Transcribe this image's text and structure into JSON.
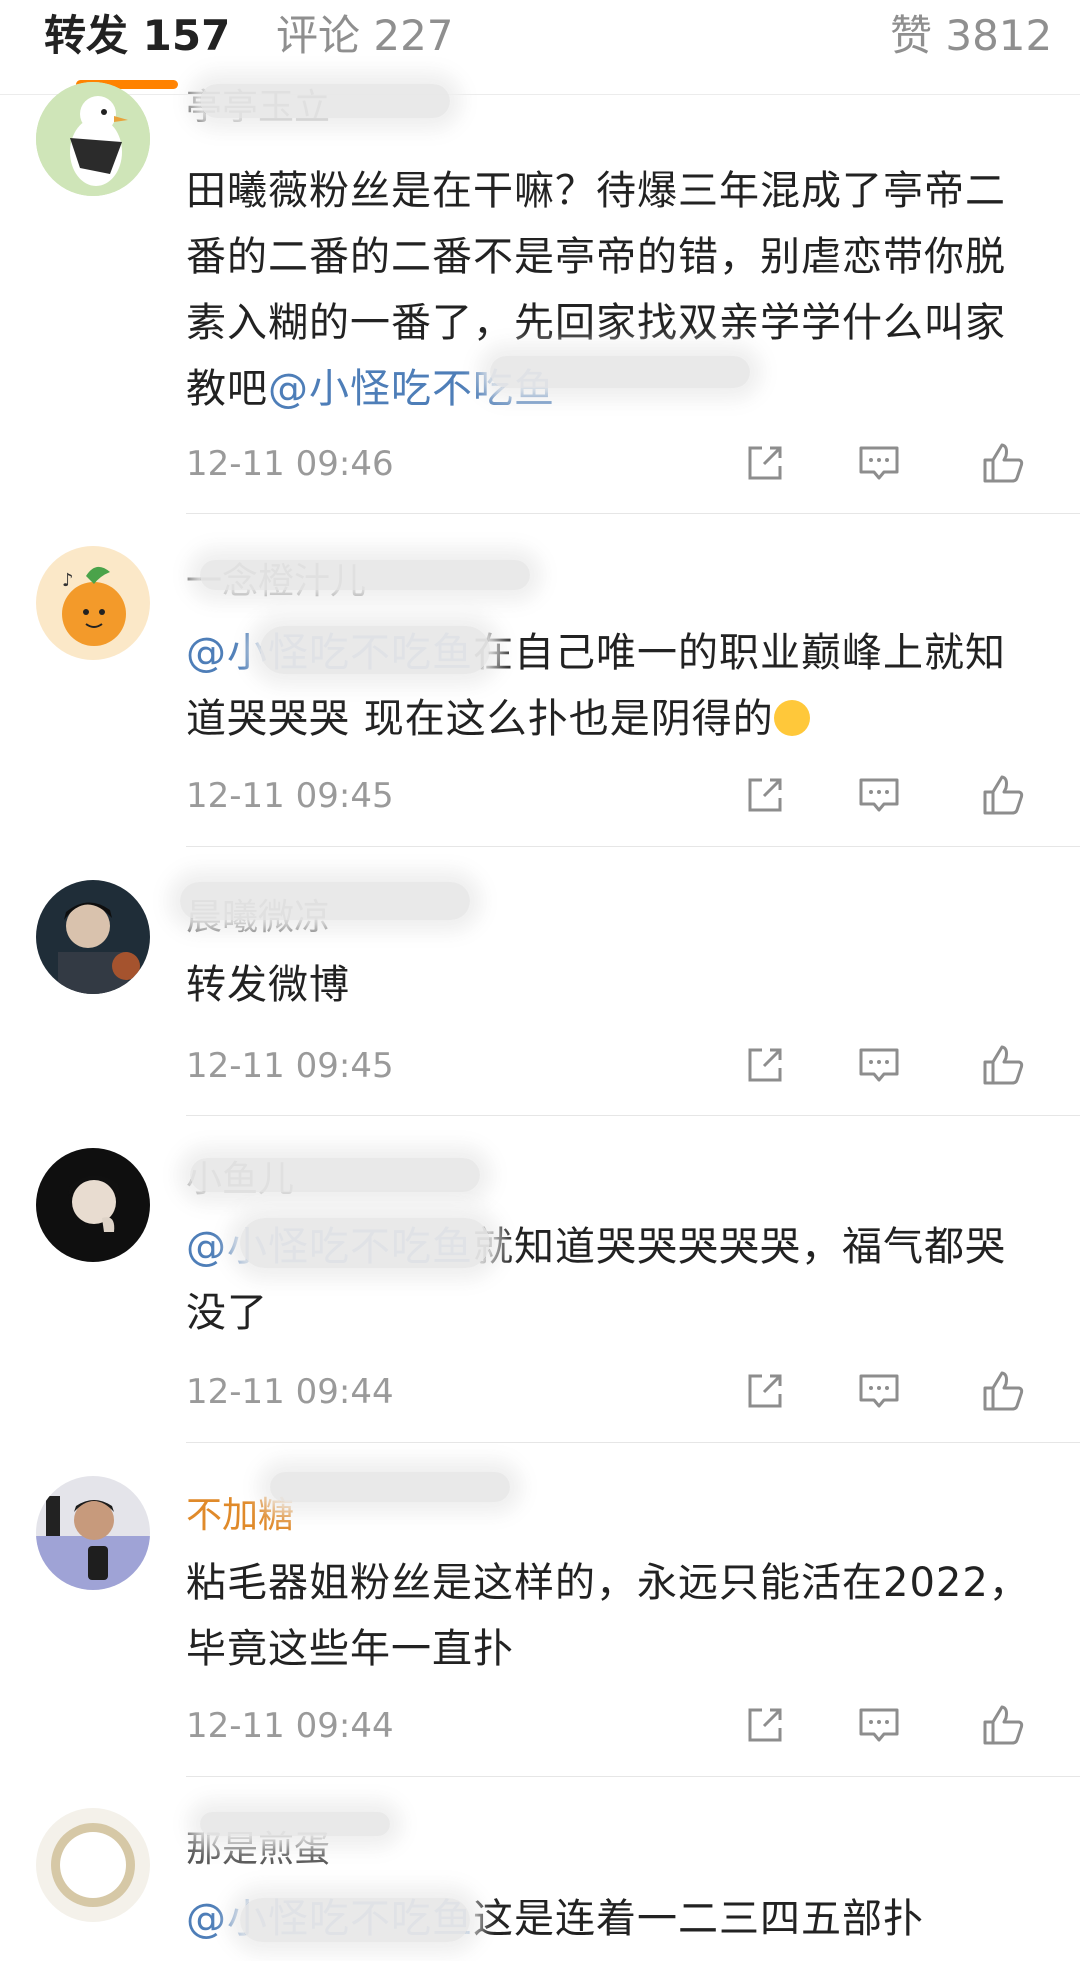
{
  "tabs": {
    "reposts": "转发 157",
    "comments": "评论 227",
    "likes": "赞 3812"
  },
  "accent_color": "#ff8200",
  "mention_color": "#4e7eb8",
  "comments": [
    {
      "username": "亭亭玉立",
      "text_before": "田曦薇粉丝是在干嘛？待爆三年混成了亭帝二番的二番的二番不是亭帝的错，别虐恋带你脱素入糊的一番了，先回家找双亲学学什么叫家教吧",
      "mention": "@小怪吃不吃鱼",
      "text_after": "",
      "time": "12-11 09:46"
    },
    {
      "username": "一念橙汁儿",
      "text_before": "",
      "mention": "@小怪吃不吃鱼",
      "text_after": "在自己唯一的职业巅峰上就知道哭哭哭 现在这么扑也是阴得的",
      "time": "12-11 09:45"
    },
    {
      "username": "晨曦微凉",
      "text_before": "转发微博",
      "mention": "",
      "text_after": "",
      "time": "12-11 09:45"
    },
    {
      "username": "小鱼儿",
      "text_before": "",
      "mention": "@小怪吃不吃鱼",
      "text_after": "就知道哭哭哭哭哭，福气都哭没了",
      "time": "12-11 09:44"
    },
    {
      "username": "不加糖",
      "text_before": "粘毛器姐粉丝是这样的，永远只能活在2022，毕竟这些年一直扑",
      "mention": "",
      "text_after": "",
      "time": "12-11 09:44"
    },
    {
      "username": "那是煎蛋",
      "text_before": "",
      "mention": "@小怪吃不吃鱼",
      "text_after": "这是连着一二三四五部扑",
      "time": ""
    }
  ],
  "icons": [
    "share-icon",
    "comment-icon",
    "like-icon"
  ]
}
